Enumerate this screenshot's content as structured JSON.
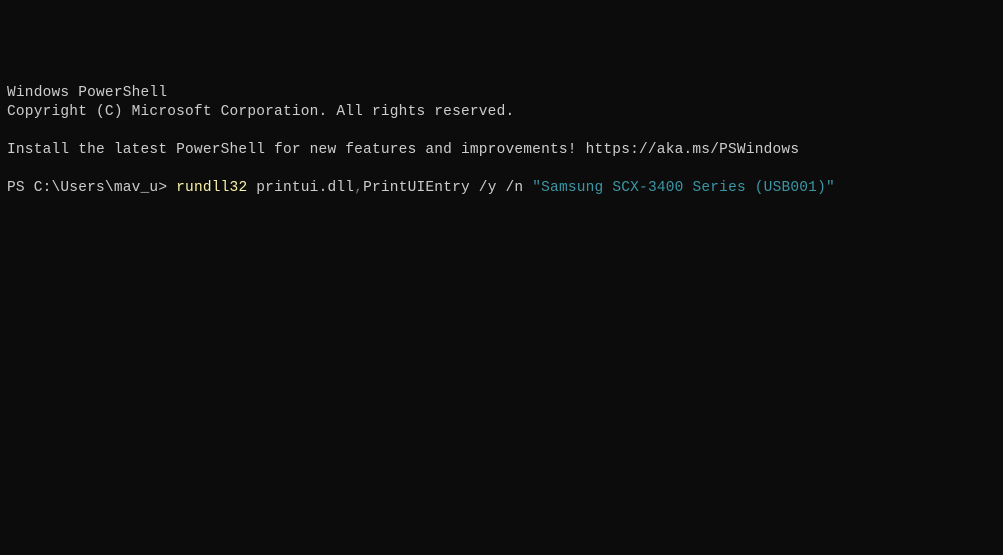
{
  "header": {
    "title": "Windows PowerShell",
    "copyright": "Copyright (C) Microsoft Corporation. All rights reserved."
  },
  "notice": {
    "install_msg": "Install the latest PowerShell for new features and improvements! https://aka.ms/PSWindows"
  },
  "prompt": {
    "prefix": "PS C:\\Users\\mav_u> ",
    "cmd_exec": "rundll32",
    "cmd_arg1": " printui.dll",
    "cmd_sep": ",",
    "cmd_arg2": "PrintUIEntry /y /n ",
    "cmd_string": "\"Samsung SCX-3400 Series (USB001)\""
  }
}
